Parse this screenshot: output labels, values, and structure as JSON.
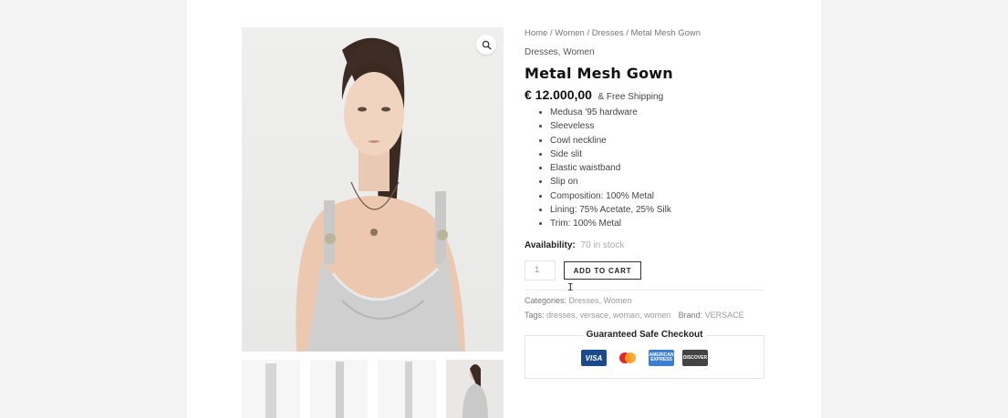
{
  "breadcrumb": {
    "home": "Home",
    "women": "Women",
    "dresses": "Dresses",
    "current": "Metal Mesh Gown",
    "sep": " / "
  },
  "product": {
    "categories_top": "Dresses, Women",
    "title": "Metal Mesh Gown",
    "price": "€ 12.000,00",
    "shipping": "& Free Shipping",
    "features": [
      "Medusa '95 hardware",
      "Sleeveless",
      "Cowl neckline",
      "Side slit",
      "Elastic waistband",
      "Slip on",
      "Composition: 100% Metal",
      "Lining: 75% Acetate, 25% Silk",
      "Trim: 100% Metal"
    ],
    "availability_label": "Availability:",
    "availability_value": "70 in stock",
    "quantity": "1",
    "add_to_cart": "ADD TO CART"
  },
  "meta": {
    "categories_label": "Categories:",
    "categories": "Dresses, Women",
    "tags_label": "Tags:",
    "tags": "dresses, versace, woman, women",
    "brand_label": "Brand:",
    "brand": "VERSACE"
  },
  "checkout": {
    "title": "Guaranteed Safe Checkout",
    "cards": [
      "VISA",
      "mastercard",
      "AMERICAN EXPRESS",
      "DISCOVER"
    ]
  },
  "colors": {
    "accent": "#111111",
    "visa": "#1a4a8c",
    "amex": "#3c7fd0"
  }
}
